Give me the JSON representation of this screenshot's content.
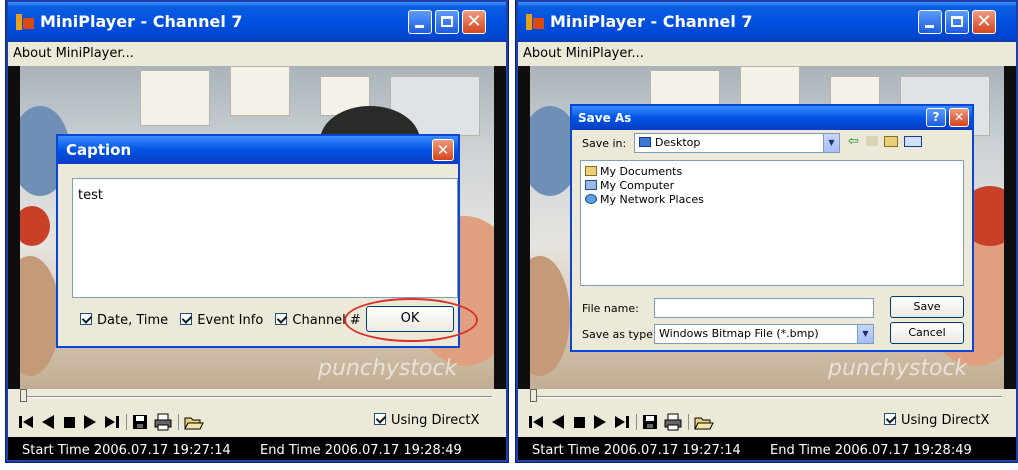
{
  "left_window": {
    "title": "MiniPlayer - Channel 7",
    "menu": "About MiniPlayer...",
    "using_directx": "Using DirectX",
    "start_time": "Start Time 2006.07.17 19:27:14",
    "end_time": "End Time 2006.07.17 19:28:49",
    "watermark": "punchystock",
    "caption_dialog": {
      "title": "Caption",
      "text": "test",
      "options": [
        "Date, Time",
        "Event Info",
        "Channel #"
      ],
      "ok_label": "OK"
    }
  },
  "right_window": {
    "title": "MiniPlayer - Channel 7",
    "menu": "About MiniPlayer...",
    "using_directx": "Using DirectX",
    "start_time": "Start Time 2006.07.17 19:27:14",
    "end_time": "End Time 2006.07.17 19:28:49",
    "watermark": "punchystock",
    "save_dialog": {
      "title": "Save As",
      "help_label": "?",
      "save_in_label": "Save in:",
      "save_in_value": "Desktop",
      "items": [
        "My Documents",
        "My Computer",
        "My Network Places"
      ],
      "file_name_label": "File name:",
      "file_name_value": "",
      "save_type_label": "Save as type:",
      "save_type_value": "Windows Bitmap File (*.bmp)",
      "save_label": "Save",
      "cancel_label": "Cancel"
    }
  },
  "colors": {
    "titlebar": "#0054e3",
    "close_button": "#d4461c",
    "window_face": "#ece9d8",
    "status_bar": "#000000",
    "highlight_ellipse": "#d8312c"
  },
  "icons": [
    "app-icon",
    "minimize-icon",
    "maximize-icon",
    "close-icon",
    "first-frame-icon",
    "prev-frame-icon",
    "stop-icon",
    "play-icon",
    "next-frame-icon",
    "save-icon",
    "print-icon",
    "open-folder-icon",
    "desktop-icon",
    "back-arrow-icon",
    "up-folder-icon",
    "new-folder-icon",
    "view-menu-icon",
    "documents-folder-icon",
    "computer-icon",
    "network-icon"
  ]
}
